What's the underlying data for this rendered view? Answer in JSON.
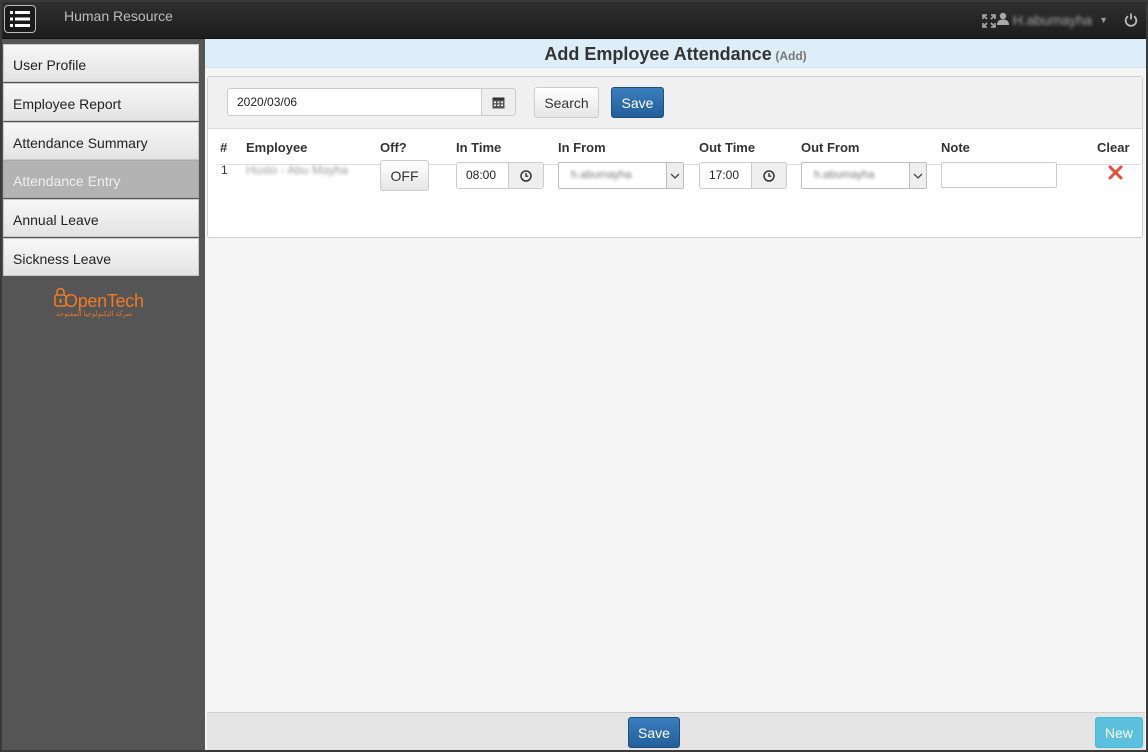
{
  "app": {
    "title": "Human Resource",
    "user": "H.abumayha",
    "icons": {
      "menu": "list-icon",
      "fullscreen": "expand-icon",
      "user": "user-icon",
      "power": "power-icon"
    }
  },
  "sidebar": {
    "items": [
      {
        "label": "User Profile",
        "active": false
      },
      {
        "label": "Employee Report",
        "active": false
      },
      {
        "label": "Attendance Summary",
        "active": false
      },
      {
        "label": "Attendance Entry",
        "active": true
      },
      {
        "label": "Annual Leave",
        "active": false
      },
      {
        "label": "Sickness Leave",
        "active": false
      }
    ],
    "logo": {
      "name": "OpenTech",
      "subtitle": "شركة التكنولوجيا المفتوحة"
    }
  },
  "page": {
    "title": "Add Employee Attendance",
    "mode": "(Add)"
  },
  "toolbar": {
    "date": "2020/03/06",
    "search_label": "Search",
    "save_label": "Save"
  },
  "table": {
    "headers": [
      "#",
      "Employee",
      "Off?",
      "In Time",
      "In From",
      "Out Time",
      "Out From",
      "Note",
      "Clear"
    ],
    "rows": [
      {
        "index": "1",
        "employee": "Husto - Abu Mayha",
        "off_label": "OFF",
        "in_time": "08:00",
        "in_from": "h.abumayha",
        "out_time": "17:00",
        "out_from": "h.abumayha",
        "note": ""
      }
    ]
  },
  "footer": {
    "save_label": "Save",
    "new_label": "New"
  },
  "colors": {
    "primary": "#2a6aa8",
    "info": "#5bc0de",
    "clear": "#e74c3c",
    "logo": "#f07a22"
  }
}
